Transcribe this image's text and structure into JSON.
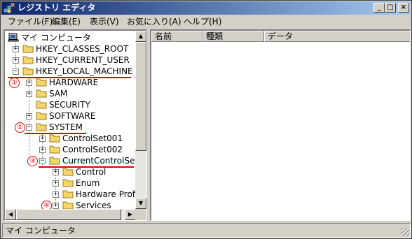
{
  "window": {
    "title": "レジストリ エディタ"
  },
  "title_buttons": {
    "minimize": "_",
    "maximize": "□",
    "close": "×"
  },
  "menu": [
    "ファイル(F)",
    "編集(E)",
    "表示(V)",
    "お気に入り(A)",
    "ヘルプ(H)"
  ],
  "tree": {
    "root": "マイ コンピュータ",
    "nodes": [
      {
        "label": "HKEY_CLASSES_ROOT",
        "expander": "+"
      },
      {
        "label": "HKEY_CURRENT_USER",
        "expander": "+"
      },
      {
        "label": "HKEY_LOCAL_MACHINE",
        "expander": "−"
      },
      {
        "label": "HARDWARE",
        "expander": "+"
      },
      {
        "label": "SAM",
        "expander": "+"
      },
      {
        "label": "SECURITY",
        "expander": ""
      },
      {
        "label": "SOFTWARE",
        "expander": "+"
      },
      {
        "label": "SYSTEM",
        "expander": "−"
      },
      {
        "label": "ControlSet001",
        "expander": "+"
      },
      {
        "label": "ControlSet002",
        "expander": "+"
      },
      {
        "label": "CurrentControlSet",
        "expander": "−"
      },
      {
        "label": "Control",
        "expander": "+"
      },
      {
        "label": "Enum",
        "expander": "+"
      },
      {
        "label": "Hardware Profile",
        "expander": "+"
      },
      {
        "label": "Services",
        "expander": "+"
      }
    ]
  },
  "annotations": [
    "①",
    "②",
    "③",
    "④"
  ],
  "list": {
    "columns": [
      "名前",
      "種類",
      "データ"
    ]
  },
  "status": {
    "text": "マイ コンピュータ"
  },
  "colors": {
    "annotation": "#e00000",
    "titlebar_start": "#0a246a",
    "titlebar_end": "#a6caf0",
    "folder": "#f5d66b"
  }
}
